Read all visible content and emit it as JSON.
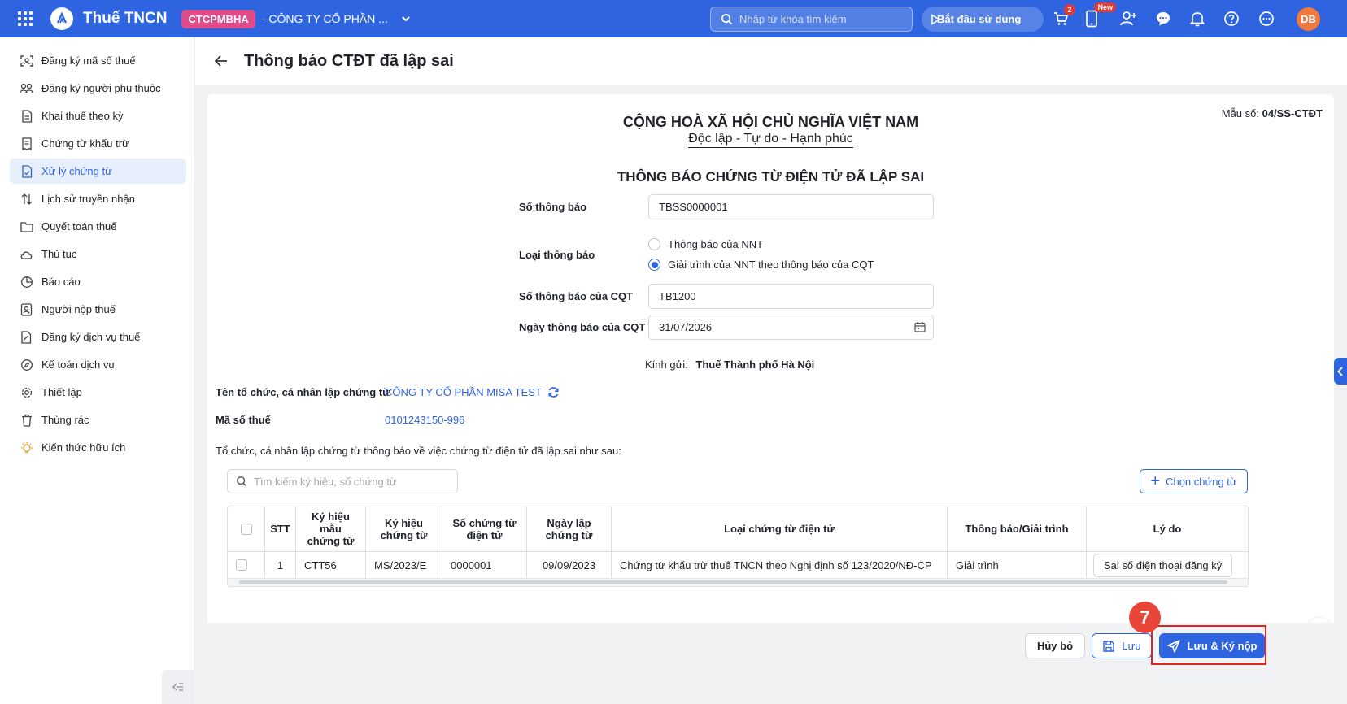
{
  "app": {
    "title": "Thuế TNCN",
    "org_code": "CTCPMBHA",
    "org_name": "- CÔNG TY CỔ PHẦN ..."
  },
  "topbar": {
    "search_placeholder": "Nhập từ khóa tìm kiếm",
    "start_label": "Bắt đầu sử dụng",
    "cart_count": "2",
    "new_label": "New",
    "avatar_initials": "DB"
  },
  "sidebar": {
    "items": [
      {
        "label": "Đăng ký mã số thuế",
        "icon": "id-scan-icon"
      },
      {
        "label": "Đăng ký người phụ thuộc",
        "icon": "people-icon"
      },
      {
        "label": "Khai thuế theo kỳ",
        "icon": "document-icon"
      },
      {
        "label": "Chứng từ khấu trừ",
        "icon": "receipt-icon"
      },
      {
        "label": "Xử lý chứng từ",
        "icon": "document-check-icon",
        "active": true
      },
      {
        "label": "Lịch sử truyền nhận",
        "icon": "transfer-icon"
      },
      {
        "label": "Quyết toán thuế",
        "icon": "folder-icon"
      },
      {
        "label": "Thủ tục",
        "icon": "cloud-icon"
      },
      {
        "label": "Báo cáo",
        "icon": "pie-chart-icon"
      },
      {
        "label": "Người nộp thuế",
        "icon": "person-card-icon"
      },
      {
        "label": "Đăng ký dịch vụ thuế",
        "icon": "document-edit-icon"
      },
      {
        "label": "Kế toán dịch vụ",
        "icon": "compass-icon"
      },
      {
        "label": "Thiết lập",
        "icon": "gear-icon"
      },
      {
        "label": "Thùng rác",
        "icon": "trash-icon"
      },
      {
        "label": "Kiến thức hữu ích",
        "icon": "lightbulb-icon"
      }
    ]
  },
  "page": {
    "title": "Thông báo CTĐT đã lập sai"
  },
  "form": {
    "gov_title": "CỘNG HOÀ XÃ HỘI CHỦ NGHĨA VIỆT NAM",
    "gov_sub_1": "Độc lập",
    "gov_sub_2": "Tự do",
    "gov_sub_3": "Hạnh phúc",
    "gov_sep": " - ",
    "form_code_label": "Mẫu số: ",
    "form_code": "04/SS-CTĐT",
    "doc_title": "THÔNG BÁO CHỨNG TỪ ĐIỆN TỬ ĐÃ LẬP SAI",
    "so_thong_bao_label": "Số thông báo",
    "so_thong_bao": "TBSS0000001",
    "loai_thong_bao_label": "Loại thông báo",
    "radio_1": "Thông báo của NNT",
    "radio_2": "Giải trình của NNT theo thông báo của CQT",
    "so_tb_cqt_label": "Số thông báo của CQT",
    "so_tb_cqt": "TB1200",
    "ngay_tb_cqt_label": "Ngày thông báo của CQT",
    "ngay_tb_cqt": "31/07/2026",
    "kinh_gui_label": "Kính gửi:",
    "kinh_gui": "Thuế Thành phố Hà Nội",
    "ten_to_chuc_label": "Tên tổ chức, cá nhân lập chứng từ",
    "ten_to_chuc": "CÔNG TY CỔ PHẦN MISA TEST",
    "mst_label": "Mã số thuế",
    "mst": "0101243150-996",
    "intro_text": "Tổ chức, cá nhân lập chứng từ thông báo về việc chứng từ điện tử đã lập sai như sau:",
    "table_search_placeholder": "Tìm kiếm ký hiệu, số chứng từ",
    "choose_label": "Chọn chứng từ"
  },
  "table": {
    "headers": [
      "STT",
      "Ký hiệu mẫu chứng từ",
      "Ký hiệu chứng từ",
      "Số chứng từ điện tử",
      "Ngày lập chứng từ",
      "Loại chứng từ điện tử",
      "Thông báo/Giải trình",
      "Lý do"
    ],
    "rows": [
      [
        "1",
        "CTT56",
        "MS/2023/E",
        "0000001",
        "09/09/2023",
        "Chứng từ khấu trừ thuế TNCN theo Nghị định số 123/2020/NĐ-CP",
        "Giải trình",
        "Sai số điện thoại đăng ký"
      ]
    ]
  },
  "footer": {
    "cancel_label": "Hủy bỏ",
    "save_label": "Lưu",
    "submit_label": "Lưu & Ký nộp",
    "step_number": "7"
  },
  "colors": {
    "primary": "#2f64e0",
    "accent_pink": "#e14b8a",
    "highlight_red": "#e02424",
    "avatar": "#f07a3d"
  }
}
